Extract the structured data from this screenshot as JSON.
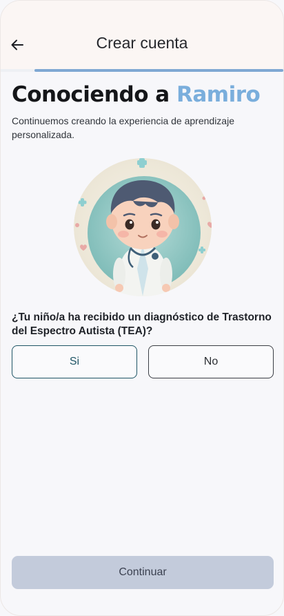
{
  "header": {
    "title": "Crear cuenta",
    "back_icon": "arrow-left-icon",
    "progress": 0.88
  },
  "intro": {
    "heading_prefix": "Conociendo a",
    "child_name": "Ramiro",
    "subtitle": "Continuemos creando la experiencia de aprendizaje personalizada."
  },
  "avatar": {
    "icon": "doctor-boy-avatar"
  },
  "question": {
    "text": "¿Tu niño/a ha recibido un diagnóstico de Trastorno del Espectro Autista (TEA)?",
    "options": [
      "Si",
      "No"
    ]
  },
  "footer": {
    "continue_label": "Continuar"
  },
  "colors": {
    "accent_name": "#7aaedc",
    "progress": "#7fa8d3",
    "selected_border": "#1f5566",
    "disabled_button": "#c3cbdb"
  }
}
